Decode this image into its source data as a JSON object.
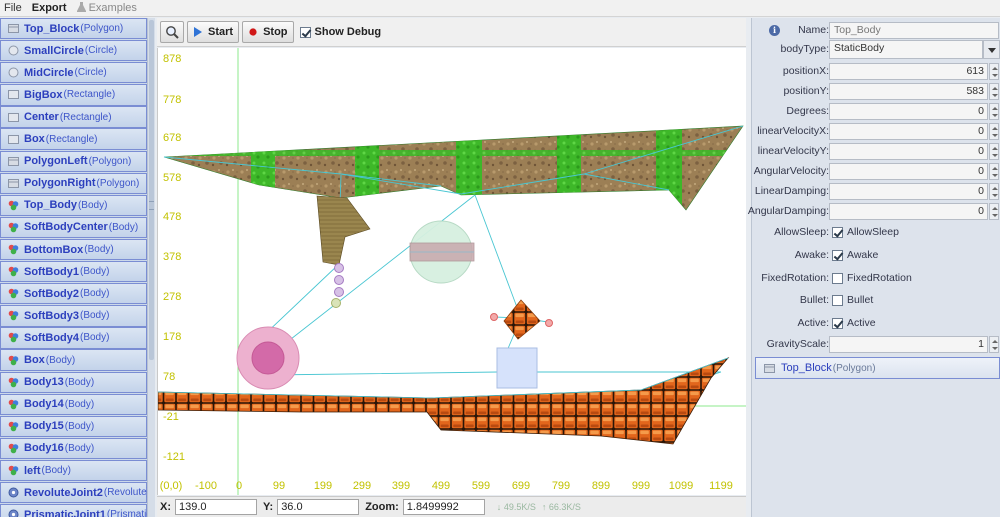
{
  "menu": {
    "file": "File",
    "export": "Export",
    "examples": "Examples"
  },
  "objects": [
    {
      "name": "Top_Block",
      "type": "(Polygon)",
      "icon": "polygon-icon"
    },
    {
      "name": "SmallCircle",
      "type": "(Circle)",
      "icon": "circle-icon"
    },
    {
      "name": "MidCircle",
      "type": "(Circle)",
      "icon": "circle-icon"
    },
    {
      "name": "BigBox",
      "type": "(Rectangle)",
      "icon": "rectangle-icon"
    },
    {
      "name": "Center",
      "type": "(Rectangle)",
      "icon": "rectangle-icon"
    },
    {
      "name": "Box",
      "type": "(Rectangle)",
      "icon": "rectangle-icon"
    },
    {
      "name": "PolygonLeft",
      "type": "(Polygon)",
      "icon": "polygon-icon"
    },
    {
      "name": "PolygonRight",
      "type": "(Polygon)",
      "icon": "polygon-icon"
    },
    {
      "name": "Top_Body",
      "type": "(Body)",
      "icon": "body-icon"
    },
    {
      "name": "SoftBodyCenter",
      "type": "(Body)",
      "icon": "body-icon"
    },
    {
      "name": "BottomBox",
      "type": "(Body)",
      "icon": "body-icon"
    },
    {
      "name": "SoftBody1",
      "type": "(Body)",
      "icon": "body-icon"
    },
    {
      "name": "SoftBody2",
      "type": "(Body)",
      "icon": "body-icon"
    },
    {
      "name": "SoftBody3",
      "type": "(Body)",
      "icon": "body-icon"
    },
    {
      "name": "SoftBody4",
      "type": "(Body)",
      "icon": "body-icon"
    },
    {
      "name": "Box",
      "type": "(Body)",
      "icon": "body-icon"
    },
    {
      "name": "Body13",
      "type": "(Body)",
      "icon": "body-icon"
    },
    {
      "name": "Body14",
      "type": "(Body)",
      "icon": "body-icon"
    },
    {
      "name": "Body15",
      "type": "(Body)",
      "icon": "body-icon"
    },
    {
      "name": "Body16",
      "type": "(Body)",
      "icon": "body-icon"
    },
    {
      "name": "left",
      "type": "(Body)",
      "icon": "body-icon"
    },
    {
      "name": "RevoluteJoint2",
      "type": "(Revolute)",
      "icon": "joint-icon"
    },
    {
      "name": "PrismaticJoint1",
      "type": "(Prismatic)",
      "icon": "joint-icon"
    }
  ],
  "toolbar": {
    "start": "Start",
    "stop": "Stop",
    "show_debug": "Show Debug",
    "show_debug_checked": true
  },
  "canvas": {
    "y_ticks": [
      "878",
      "778",
      "678",
      "578",
      "478",
      "378",
      "278",
      "178",
      "78",
      "-21",
      "-121"
    ],
    "x_ticks": [
      "(0,0)",
      "-100",
      "0",
      "99",
      "199",
      "299",
      "399",
      "499",
      "599",
      "699",
      "799",
      "899",
      "999",
      "1099",
      "1199"
    ]
  },
  "status": {
    "x_label": "X:",
    "x_value": "139.0",
    "y_label": "Y:",
    "y_value": "36.0",
    "zoom_label": "Zoom:",
    "zoom_value": "1.8499992",
    "net_down": "49.5K/S",
    "net_up": "66.3K/S"
  },
  "properties": {
    "name_label": "Name:",
    "name_value": "Top_Body",
    "bodytype_label": "bodyType:",
    "bodytype_value": "StaticBody",
    "posx_label": "positionX:",
    "posx_value": "613",
    "posy_label": "positionY:",
    "posy_value": "583",
    "degrees_label": "Degrees:",
    "degrees_value": "0",
    "lvx_label": "linearVelocityX:",
    "lvx_value": "0",
    "lvy_label": "linearVelocityY:",
    "lvy_value": "0",
    "angvel_label": "AngularVelocity:",
    "angvel_value": "0",
    "lindamp_label": "LinearDamping:",
    "lindamp_value": "0",
    "angdamp_label": "AngularDamping:",
    "angdamp_value": "0",
    "allowsleep_label": "AllowSleep:",
    "allowsleep_text": "AllowSleep",
    "allowsleep_checked": true,
    "awake_label": "Awake:",
    "awake_text": "Awake",
    "awake_checked": true,
    "fixedrot_label": "FixedRotation:",
    "fixedrot_text": "FixedRotation",
    "fixedrot_checked": false,
    "bullet_label": "Bullet:",
    "bullet_text": "Bullet",
    "bullet_checked": false,
    "active_label": "Active:",
    "active_text": "Active",
    "active_checked": true,
    "gravity_label": "GravityScale:",
    "gravity_value": "1",
    "shape_name": "Top_Block",
    "shape_type": "(Polygon)"
  },
  "colors": {
    "accent": "#2c3fbd",
    "axis_label": "#c8c800",
    "grass": "#3fbf2a",
    "dirt": "#9b7d55",
    "brick": "#e06a1e"
  }
}
